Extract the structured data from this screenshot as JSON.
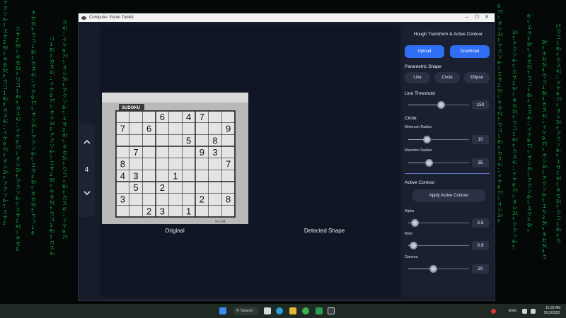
{
  "window": {
    "title": "Computer Vision Toolkit"
  },
  "nav": {
    "up_icon": "chevron-up",
    "number": "4",
    "down_icon": "chevron-down"
  },
  "images": {
    "original_caption": "Original",
    "detected_caption": "Detected Shape"
  },
  "sudoku": {
    "header": "SUDOKU",
    "footer": "9-1-09",
    "grid": [
      [
        "",
        "",
        "",
        "6",
        "",
        "4",
        "7",
        "",
        ""
      ],
      [
        "7",
        "",
        "6",
        "",
        "",
        "",
        "",
        "",
        "9"
      ],
      [
        "",
        "",
        "",
        "",
        "",
        "5",
        "",
        "8",
        ""
      ],
      [
        "",
        "7",
        "",
        "",
        "",
        "",
        "9",
        "3",
        ""
      ],
      [
        "8",
        "",
        "",
        "",
        "",
        "",
        "",
        "",
        "7"
      ],
      [
        "4",
        "3",
        "",
        "",
        "1",
        "",
        "",
        "",
        ""
      ],
      [
        "",
        "5",
        "",
        "2",
        "",
        "",
        "",
        "",
        ""
      ],
      [
        "3",
        "",
        "",
        "",
        "",
        "",
        "2",
        "",
        "8"
      ],
      [
        "",
        "",
        "2",
        "3",
        "",
        "1",
        "",
        "",
        ""
      ]
    ]
  },
  "panel": {
    "title": "Hough Transform & Active Contour",
    "upload_label": "Upload",
    "download_label": "Download",
    "param_shape_label": "Parametric Shape",
    "shapes": [
      "Line",
      "Circle",
      "Ellipse"
    ],
    "line_threshold": {
      "label": "Line Threshold",
      "value": "150",
      "fraction": 0.53
    },
    "circle": {
      "label": "Circle",
      "min_radius": {
        "label": "Minimum Radius",
        "value": "10",
        "fraction": 0.3
      },
      "max_radius": {
        "label": "Maximim Radius",
        "value": "35",
        "fraction": 0.34
      }
    },
    "active_contour": {
      "label": "Active Contour",
      "apply_label": "Apply Active Contour",
      "alpha": {
        "label": "Alpha",
        "value": "2.5",
        "fraction": 0.1
      },
      "beta": {
        "label": "Beta",
        "value": "0.9",
        "fraction": 0.08
      },
      "gamma": {
        "label": "Gamma",
        "value": "20",
        "fraction": 0.41
      }
    }
  },
  "taskbar": {
    "search_label": "Search",
    "lang": "ENG",
    "time": "12:32 AM",
    "date": "5/12/2023"
  }
}
